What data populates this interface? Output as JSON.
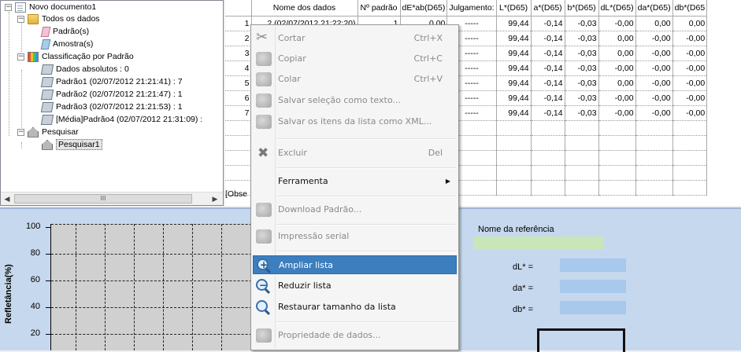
{
  "tree": {
    "root": "Novo documento1",
    "all_data": "Todos os dados",
    "standards": "Padrão(s)",
    "samples": "Amostra(s)",
    "classification": "Classificação por Padrão",
    "absolute": "Dados absolutos : 0",
    "p1": "Padrão1 (02/07/2012 21:21:41) : 7",
    "p2": "Padrão2 (02/07/2012 21:21:47) : 1",
    "p3": "Padrão3 (02/07/2012 21:21:53) : 1",
    "p4": "[Média]Padrão4 (02/07/2012 21:31:09) :",
    "search": "Pesquisar",
    "search1": "Pesquisar1",
    "scroll_thumb": "III"
  },
  "grid": {
    "headers": [
      "",
      "Nome dos dados",
      "Nº padrão",
      "dE*ab(D65)",
      "Julgamento:",
      "L*(D65)",
      "a*(D65)",
      "b*(D65)",
      "dL*(D65)",
      "da*(D65)",
      "db*(D65"
    ],
    "rows": [
      [
        "1",
        "2 (02/07/2012 21:22:20)",
        "1",
        "0,00",
        "-----",
        "99,44",
        "-0,14",
        "-0,03",
        "-0,00",
        "0,00",
        "0,00"
      ],
      [
        "2",
        "",
        "",
        "00",
        "-----",
        "99,44",
        "-0,14",
        "-0,03",
        "0,00",
        "-0,00",
        "-0,00"
      ],
      [
        "3",
        "",
        "",
        "00",
        "-----",
        "99,44",
        "-0,14",
        "-0,03",
        "0,00",
        "-0,00",
        "-0,00"
      ],
      [
        "4",
        "",
        "",
        "00",
        "-----",
        "99,44",
        "-0,14",
        "-0,03",
        "-0,00",
        "-0,00",
        "-0,00"
      ],
      [
        "5",
        "",
        "",
        "00",
        "-----",
        "99,44",
        "-0,14",
        "-0,03",
        "0,00",
        "-0,00",
        "-0,00"
      ],
      [
        "6",
        "",
        "",
        "00",
        "-----",
        "99,44",
        "-0,14",
        "-0,03",
        "-0,00",
        "-0,00",
        "-0,00"
      ],
      [
        "7",
        "",
        "",
        "00",
        "-----",
        "99,44",
        "-0,14",
        "-0,03",
        "-0,00",
        "-0,00",
        "-0,00"
      ],
      [
        "",
        "",
        "",
        "",
        "",
        "",
        "",
        "",
        "",
        "",
        ""
      ],
      [
        "",
        "",
        "",
        "",
        "",
        "",
        "",
        "",
        "",
        "",
        ""
      ],
      [
        "",
        "",
        "",
        "",
        "",
        "",
        "",
        "",
        "",
        "",
        ""
      ],
      [
        "",
        "",
        "",
        "",
        "",
        "",
        "",
        "",
        "",
        "",
        ""
      ],
      [
        "",
        "",
        "",
        "",
        "",
        "",
        "",
        "",
        "",
        "",
        ""
      ]
    ],
    "obs_label": "[Obse"
  },
  "chart": {
    "ylabel": "Refletância(%)",
    "ticks": [
      "100",
      "80",
      "60",
      "40",
      "20"
    ]
  },
  "reference": {
    "label": "Nome da referência",
    "dl": "dL* =",
    "da": "da* =",
    "db": "db* ="
  },
  "menu": {
    "cut": "Cortar",
    "cut_sc": "Ctrl+X",
    "copy": "Copiar",
    "copy_sc": "Ctrl+C",
    "paste": "Colar",
    "paste_sc": "Ctrl+V",
    "save_sel": "Salvar seleção como texto...",
    "save_xml": "Salvar os itens da lista como XML...",
    "delete": "Excluir",
    "delete_sc": "Del",
    "tool": "Ferramenta",
    "download": "Download Padrão...",
    "serial": "Impressão serial",
    "zoom_in": "Ampliar lista",
    "zoom_out": "Reduzir lista",
    "restore": "Restaurar tamanho da lista",
    "props": "Propriedade de dados..."
  },
  "colors": {
    "highlight": "#3d7ebf",
    "panel": "#c6d8ed",
    "ref_name_box": "#c8e6b8",
    "value_box": "#a8c8ec"
  }
}
